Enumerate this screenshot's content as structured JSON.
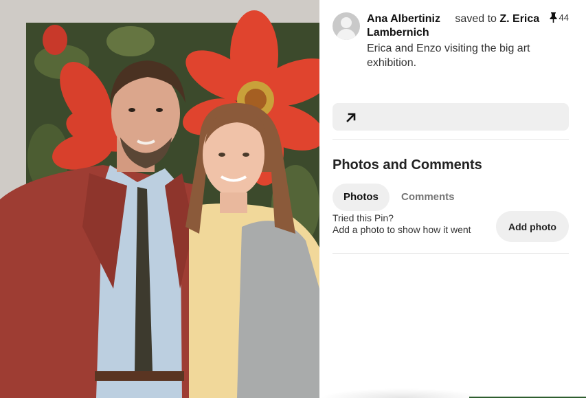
{
  "pin": {
    "image_alt": "Erica and Enzo in front of a large red flower painting",
    "pin_count": "44"
  },
  "author": {
    "name": "Ana Albertiniz",
    "saved_text": "saved to",
    "board": "Z. Erica Lambernich"
  },
  "description": "Erica and Enzo visiting the big art exhibition.",
  "section": {
    "title": "Photos and Comments",
    "tabs": [
      {
        "label": "Photos",
        "active": true
      },
      {
        "label": "Comments",
        "active": false
      }
    ],
    "tried_line1": "Tried this Pin?",
    "tried_line2": "Add a photo to show how it went",
    "add_photo_label": "Add photo"
  },
  "colors": {
    "accent_gray": "#efefef",
    "text_muted": "#767676"
  },
  "icons": {
    "avatar": "user-avatar-icon",
    "pin": "pushpin-icon",
    "link": "arrow-up-right-icon"
  }
}
